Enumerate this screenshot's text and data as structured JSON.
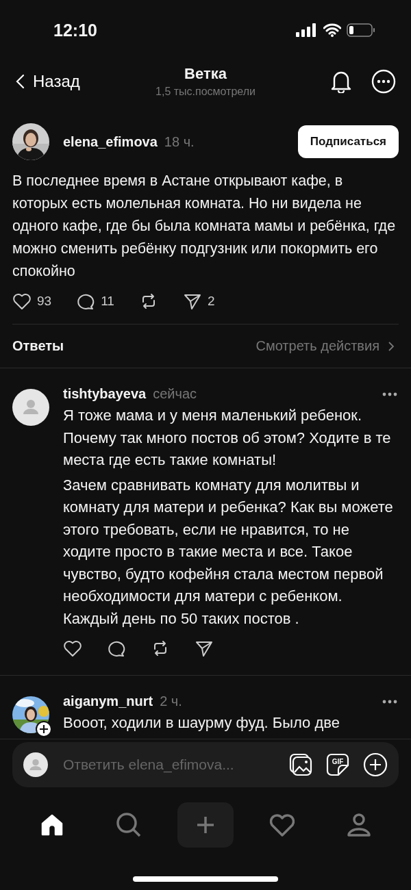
{
  "status_bar": {
    "time": "12:10"
  },
  "header": {
    "back_label": "Назад",
    "title": "Ветка",
    "subtitle": "1,5 тыс.посмотрели"
  },
  "post": {
    "author": "elena_efimova",
    "time": "18 ч.",
    "follow_button": "Подписаться",
    "text": "В последнее время в Астане открывают кафе, в которых есть молельная комната. Но ни видела не одного кафе, где бы была комната мамы и ребёнка, где можно сменить ребёнку подгузник или покормить его спокойно",
    "actions": [
      {
        "kind": "like",
        "count": "93"
      },
      {
        "kind": "reply",
        "count": "11"
      },
      {
        "kind": "repost"
      },
      {
        "kind": "share",
        "count": "2"
      }
    ]
  },
  "replies_header": {
    "title": "Ответы",
    "link": "Смотреть действия"
  },
  "replies": [
    {
      "author": "tishtybayeva",
      "time": "сейчас",
      "avatar": {
        "kind": "default"
      },
      "follow_badge": false,
      "paragraphs": [
        "Я тоже мама и у меня маленький ребенок. Почему так много постов об этом? Ходите в те места где есть такие комнаты!",
        "Зачем сравнивать комнату для молитвы и комнату для матери и ребенка? Как вы можете этого требовать, если не нравится, то не ходите просто в такие места и все. Такое чувство, будто кофейня стала местом первой необходимости для матери с ребенком. Каждый день по 50 таких постов ."
      ],
      "actions": [
        {
          "kind": "like"
        },
        {
          "kind": "reply"
        },
        {
          "kind": "repost"
        },
        {
          "kind": "share"
        }
      ]
    },
    {
      "author": "aiganym_nurt",
      "time": "2 ч.",
      "avatar": {
        "kind": "picture"
      },
      "follow_badge": true,
      "paragraphs": [
        "Вооот, ходили в шаурму фуд. Было две"
      ]
    }
  ],
  "composer": {
    "placeholder": "Ответить elena_efimova...",
    "gif_label": "GIF"
  },
  "tab_bar": [
    {
      "kind": "home",
      "selected": true
    },
    {
      "kind": "search",
      "selected": false
    },
    {
      "kind": "create",
      "selected": false
    },
    {
      "kind": "activity",
      "selected": false
    },
    {
      "kind": "profile",
      "selected": false
    }
  ]
}
